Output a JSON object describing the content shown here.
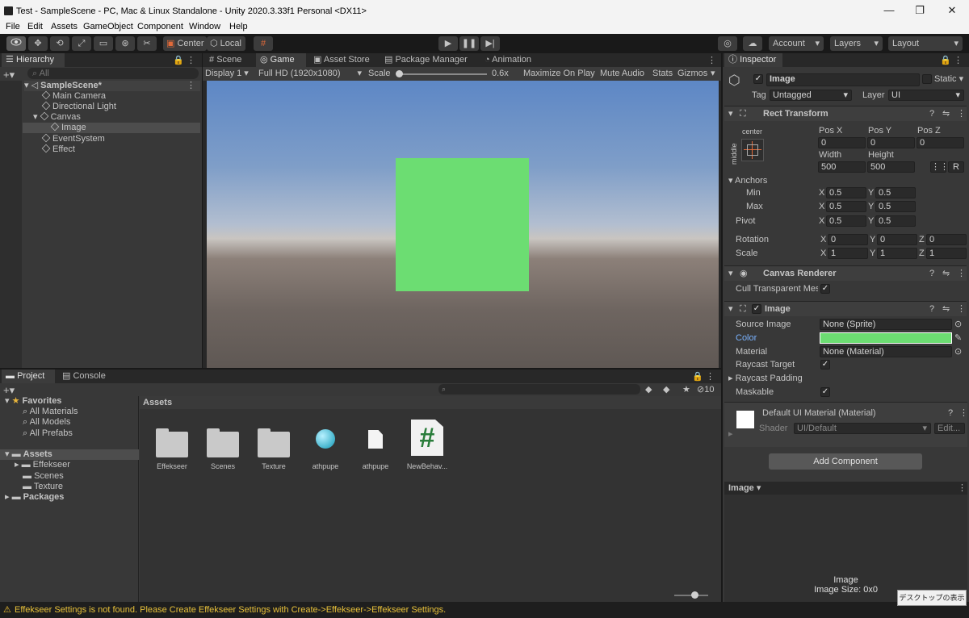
{
  "window": {
    "title": "Test - SampleScene - PC, Mac & Linux Standalone - Unity 2020.3.33f1 Personal <DX11>",
    "minimize": "—",
    "maximize": "❐",
    "close": "✕"
  },
  "menu": [
    "File",
    "Edit",
    "Assets",
    "GameObject",
    "Component",
    "Window",
    "Help"
  ],
  "toolbar": {
    "center_label": "Center",
    "local_label": "Local",
    "account_label": "Account",
    "layers_label": "Layers",
    "layout_label": "Layout"
  },
  "hierarchy": {
    "tab": "Hierarchy",
    "search_placeholder": "All",
    "scene": "SampleScene*",
    "items": [
      "Main Camera",
      "Directional Light",
      "Canvas",
      "Image",
      "EventSystem",
      "Effect"
    ]
  },
  "center_tabs": [
    "Scene",
    "Game",
    "Asset Store",
    "Package Manager",
    "Animation"
  ],
  "game_bar": {
    "display": "Display 1",
    "resolution": "Full HD (1920x1080)",
    "scale_label": "Scale",
    "scale_value": "0.6x",
    "maximize": "Maximize On Play",
    "mute": "Mute Audio",
    "stats": "Stats",
    "gizmos": "Gizmos"
  },
  "game_view": {
    "image_color": "#6cdd72"
  },
  "project": {
    "tab_project": "Project",
    "tab_console": "Console",
    "hidden_count": "10",
    "favorites_label": "Favorites",
    "favorites": [
      "All Materials",
      "All Models",
      "All Prefabs"
    ],
    "assets_label": "Assets",
    "asset_folders": [
      "Effekseer",
      "Scenes",
      "Texture"
    ],
    "packages_label": "Packages",
    "breadcrumb": "Assets",
    "items": [
      "Effekseer",
      "Scenes",
      "Texture",
      "athpupe",
      "athpupe",
      "NewBehav..."
    ],
    "script_glyph": "#"
  },
  "inspector": {
    "tab": "Inspector",
    "name": "Image",
    "static_label": "Static",
    "tag_label": "Tag",
    "tag_value": "Untagged",
    "layer_label": "Layer",
    "layer_value": "UI",
    "rect_transform": {
      "title": "Rect Transform",
      "anchor_h": "center",
      "anchor_v": "middle",
      "pos_x_label": "Pos X",
      "pos_y_label": "Pos Y",
      "pos_z_label": "Pos Z",
      "pos_x": "0",
      "pos_y": "0",
      "pos_z": "0",
      "width_label": "Width",
      "height_label": "Height",
      "width": "500",
      "height": "500",
      "raw_edit": "R",
      "anchors_label": "Anchors",
      "min_label": "Min",
      "max_label": "Max",
      "pivot_label": "Pivot",
      "min_x": "0.5",
      "min_y": "0.5",
      "max_x": "0.5",
      "max_y": "0.5",
      "pivot_x": "0.5",
      "pivot_y": "0.5",
      "rotation_label": "Rotation",
      "scale_label": "Scale",
      "rot_x": "0",
      "rot_y": "0",
      "rot_z": "0",
      "scale_x": "1",
      "scale_y": "1",
      "scale_z": "1",
      "x": "X",
      "y": "Y",
      "z": "Z"
    },
    "canvas_renderer": {
      "title": "Canvas Renderer",
      "cull_label": "Cull Transparent Mes"
    },
    "image": {
      "title": "Image",
      "source_label": "Source Image",
      "source_value": "None (Sprite)",
      "color_label": "Color",
      "color_value": "#6cdd72",
      "material_label": "Material",
      "material_value": "None (Material)",
      "raycast_target": "Raycast Target",
      "raycast_padding": "Raycast Padding",
      "maskable": "Maskable"
    },
    "material": {
      "name": "Default UI Material (Material)",
      "shader_label": "Shader",
      "shader_value": "UI/Default",
      "edit": "Edit..."
    },
    "add_component": "Add Component",
    "preview_label": "Image",
    "preview_caption": "Image",
    "preview_size": "Image Size: 0x0",
    "help": "?",
    "check": "✓"
  },
  "statusbar": {
    "message": "Effekseer Settings is not found. Please Create Effekseer Settings with Create->Effekseer->Effekseer Settings."
  },
  "tooltip": "デスクトップの表示"
}
